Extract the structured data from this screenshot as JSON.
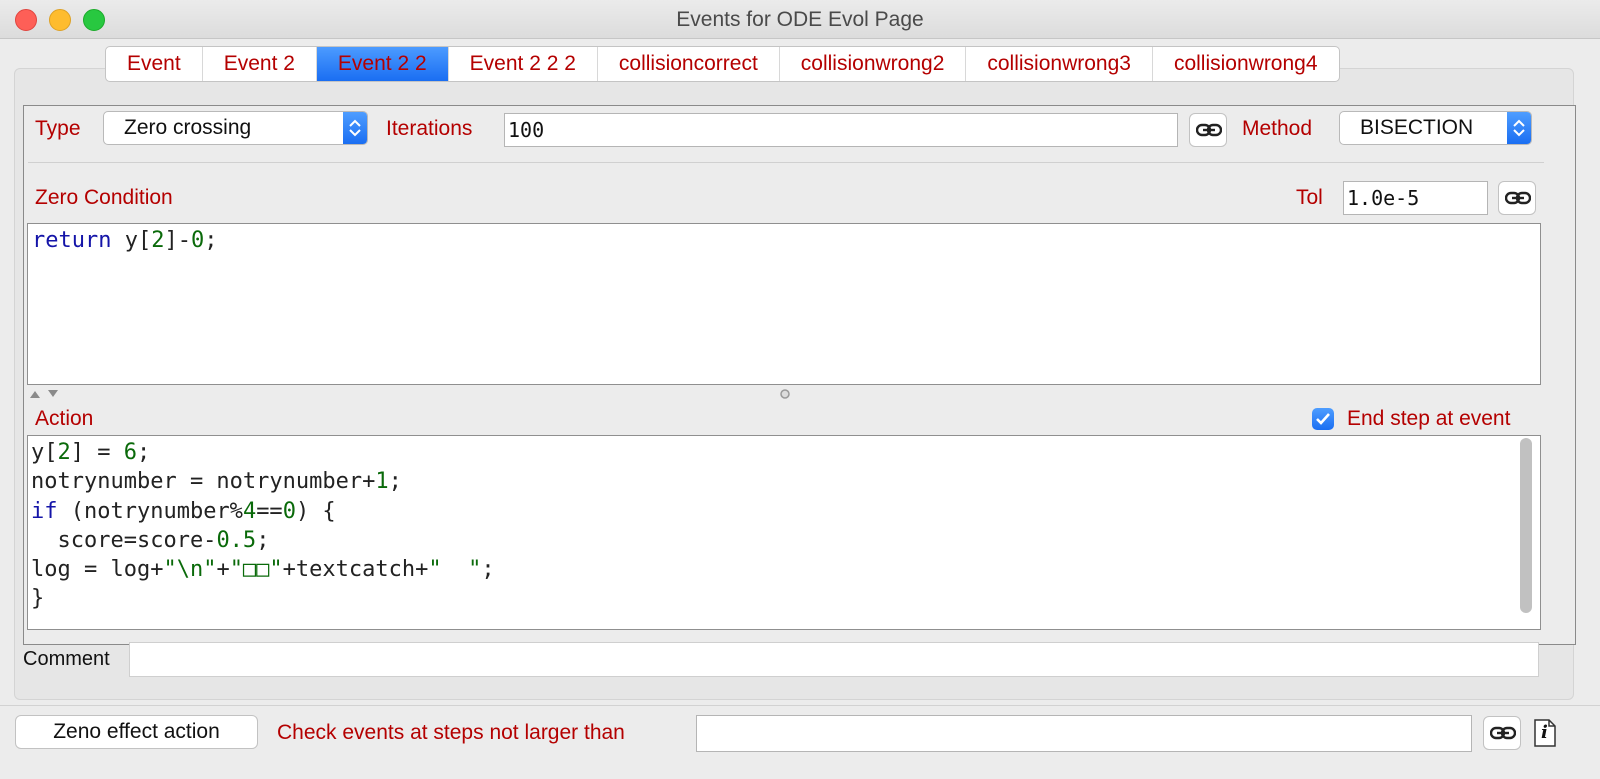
{
  "window": {
    "title": "Events for ODE Evol Page"
  },
  "tabs": [
    {
      "label": "Event"
    },
    {
      "label": "Event 2"
    },
    {
      "label": "Event 2 2",
      "active": true
    },
    {
      "label": "Event 2 2 2"
    },
    {
      "label": "collisioncorrect"
    },
    {
      "label": "collisionwrong2"
    },
    {
      "label": "collisionwrong3"
    },
    {
      "label": "collisionwrong4"
    }
  ],
  "event": {
    "type_label": "Type",
    "type_value": "Zero crossing",
    "iterations_label": "Iterations",
    "iterations_value": "100",
    "method_label": "Method",
    "method_value": "BISECTION",
    "zero_condition_label": "Zero Condition",
    "tol_label": "Tol",
    "tol_value": "1.0e-5",
    "zero_condition_code": [
      "return y[2]-0;"
    ],
    "action_label": "Action",
    "end_step_label": "End step at event",
    "end_step_checked": true,
    "action_code": [
      "y[2] = 6;",
      "notrynumber = notrynumber+1;",
      "if (notrynumber%4==0) {",
      "  score=score-0.5;",
      "log = log+\"\\n\"+\"□□\"+textcatch+\"  \";",
      "}"
    ],
    "comment_label": "Comment",
    "comment_value": ""
  },
  "footer": {
    "zeno_button_label": "Zeno effect action",
    "check_steps_label": "Check events at steps not larger than",
    "check_steps_value": "",
    "info_icon_glyph": "i"
  },
  "icons": {
    "link": "link-icon",
    "info": "info-document-icon",
    "checkmark": "checkmark-icon",
    "updown": "updown-arrows-icon"
  },
  "colors": {
    "label_red": "#b40000",
    "accent_blue": "#1a6ef2",
    "keyword_blue": "#1414a8",
    "literal_green": "#0a6a0a"
  }
}
